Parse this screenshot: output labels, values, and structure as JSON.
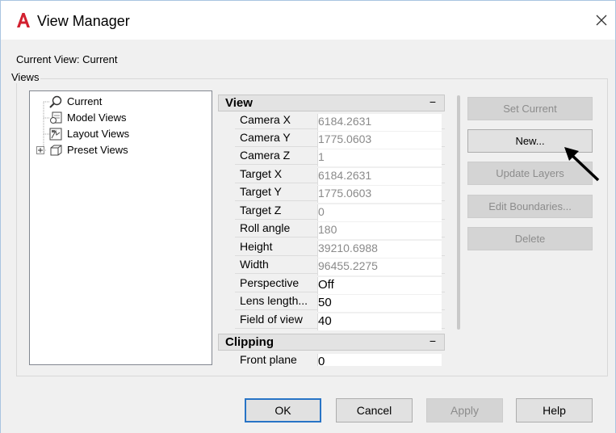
{
  "window": {
    "title": "View Manager",
    "app_icon": "autocad-a-logo",
    "close_icon": "close-x-icon"
  },
  "current_view": "Current View: Current",
  "views_group_label": "Views",
  "tree": {
    "items": [
      {
        "label": "Current",
        "icon": "magnifier-icon"
      },
      {
        "label": "Model Views",
        "icon": "model-views-icon"
      },
      {
        "label": "Layout Views",
        "icon": "layout-views-icon"
      },
      {
        "label": "Preset Views",
        "icon": "preset-views-icon",
        "expander": "+"
      }
    ]
  },
  "properties": {
    "view_section": {
      "title": "View",
      "collapse": "−",
      "rows": [
        {
          "name": "Camera X",
          "value": "6184.2631"
        },
        {
          "name": "Camera Y",
          "value": "1775.0603"
        },
        {
          "name": "Camera Z",
          "value": "1"
        },
        {
          "name": "Target X",
          "value": "6184.2631"
        },
        {
          "name": "Target Y",
          "value": "1775.0603"
        },
        {
          "name": "Target Z",
          "value": "0"
        },
        {
          "name": "Roll angle",
          "value": "180"
        },
        {
          "name": "Height",
          "value": "39210.6988"
        },
        {
          "name": "Width",
          "value": "96455.2275"
        },
        {
          "name": "Perspective",
          "value": "Off"
        },
        {
          "name": "Lens  length...",
          "value": "50"
        },
        {
          "name": "Field of view",
          "value": "40"
        }
      ]
    },
    "clipping_section": {
      "title": "Clipping",
      "collapse": "−",
      "rows": [
        {
          "name": "Front plane",
          "value": "0"
        }
      ]
    }
  },
  "side_buttons": {
    "set_current": "Set Current",
    "new": "New...",
    "update_layers": "Update Layers",
    "edit_boundaries": "Edit Boundaries...",
    "delete": "Delete"
  },
  "bottom_buttons": {
    "ok": "OK",
    "cancel": "Cancel",
    "apply": "Apply",
    "help": "Help"
  },
  "colors": {
    "logo_red": "#d2202f",
    "default_button_border": "#2874c6",
    "client_bg": "#f0f0f0"
  }
}
